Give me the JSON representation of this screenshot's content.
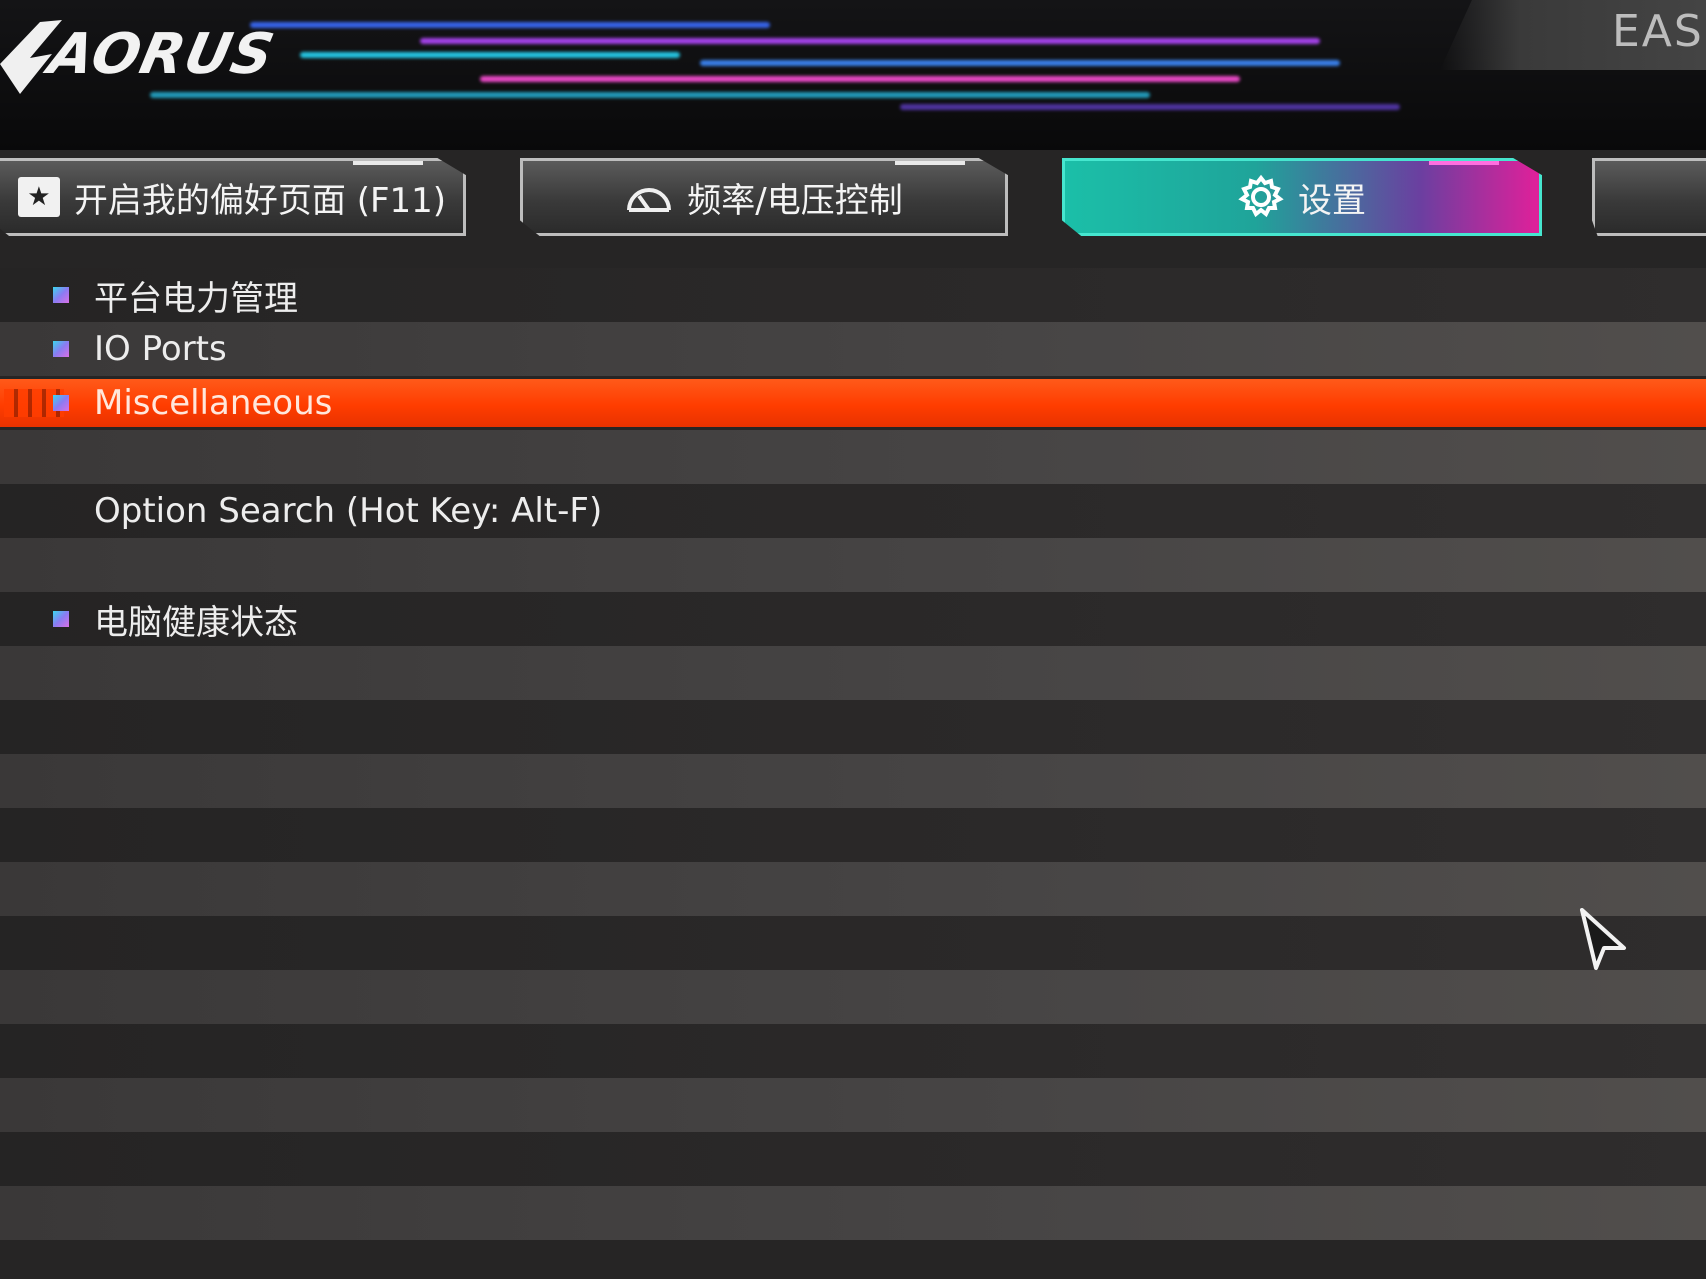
{
  "brand": {
    "logo_text": "AORUS",
    "mode_tab": "EAS"
  },
  "tabs": [
    {
      "label": "开启我的偏好页面 (F11)",
      "icon": "star-icon"
    },
    {
      "label": "频率/电压控制",
      "icon": "speedometer-icon"
    },
    {
      "label": "设置",
      "icon": "gear-icon"
    },
    {
      "label": "",
      "icon": ""
    }
  ],
  "menu": {
    "items": [
      {
        "label": "平台电力管理",
        "has_bullet": true
      },
      {
        "label": "IO Ports",
        "has_bullet": true
      },
      {
        "label": "Miscellaneous",
        "has_bullet": true,
        "selected": true
      },
      {
        "label": "",
        "has_bullet": false
      },
      {
        "label": "Option Search (Hot Key: Alt-F)",
        "has_bullet": false
      },
      {
        "label": "",
        "has_bullet": false
      },
      {
        "label": "电脑健康状态",
        "has_bullet": true
      }
    ]
  },
  "colors": {
    "selected_row": "#ff3d00",
    "active_tab_start": "#1bbfa8",
    "active_tab_end": "#e0209a",
    "bullet": "#8a7bf2"
  }
}
